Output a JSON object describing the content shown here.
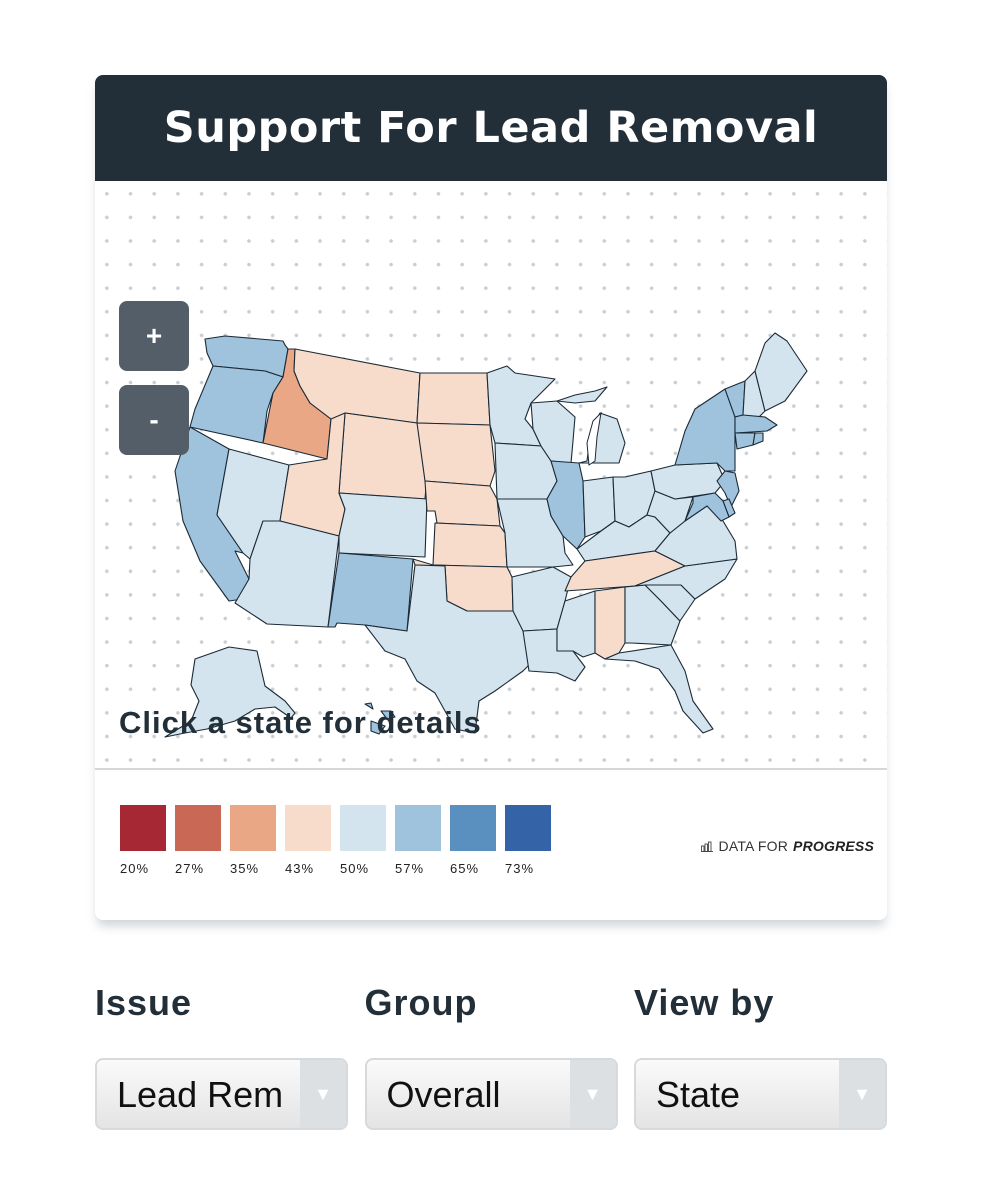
{
  "title": "Support For Lead Removal",
  "zoom_controls": {
    "zoom_in": "+",
    "zoom_out": "-"
  },
  "hint": "Click a state for details",
  "legend": {
    "items": [
      {
        "label": "20%",
        "color": "#a52834"
      },
      {
        "label": "27%",
        "color": "#c96955"
      },
      {
        "label": "35%",
        "color": "#e9a785"
      },
      {
        "label": "43%",
        "color": "#f7dccb"
      },
      {
        "label": "50%",
        "color": "#d4e4ef"
      },
      {
        "label": "57%",
        "color": "#9fc3dd"
      },
      {
        "label": "65%",
        "color": "#5a90c0"
      },
      {
        "label": "73%",
        "color": "#3563a8"
      }
    ]
  },
  "brand": {
    "icon": "bar-chart-icon",
    "prefix": "DATA FOR",
    "emphasis": "PROGRESS"
  },
  "controls": [
    {
      "label": "Issue",
      "value": "Lead Rem"
    },
    {
      "label": "Group",
      "value": "Overall"
    },
    {
      "label": "View by",
      "value": "State"
    }
  ],
  "map": {
    "colors": {
      "low": "#f7dccb",
      "mid_low": "#e9a785",
      "neutral": "#d4e4ef",
      "mid_high": "#9fc3dd"
    },
    "states": {
      "WA": "mid_high",
      "OR": "mid_high",
      "CA": "mid_high",
      "ID": "mid_low",
      "NV": "neutral",
      "MT": "low",
      "WY": "low",
      "UT": "low",
      "AZ": "neutral",
      "CO": "neutral",
      "NM": "mid_high",
      "ND": "low",
      "SD": "low",
      "NE": "low",
      "KS": "low",
      "OK": "low",
      "TX": "neutral",
      "MN": "neutral",
      "IA": "neutral",
      "MO": "neutral",
      "AR": "neutral",
      "LA": "neutral",
      "WI": "neutral",
      "IL": "mid_high",
      "MI": "neutral",
      "IN": "neutral",
      "OH": "neutral",
      "KY": "neutral",
      "TN": "low",
      "MS": "neutral",
      "AL": "low",
      "GA": "neutral",
      "FL": "neutral",
      "SC": "neutral",
      "NC": "neutral",
      "VA": "neutral",
      "WV": "neutral",
      "PA": "neutral",
      "NY": "mid_high",
      "VT": "mid_high",
      "NH": "neutral",
      "ME": "neutral",
      "MA": "mid_high",
      "CT": "mid_high",
      "RI": "mid_high",
      "NJ": "mid_high",
      "DE": "mid_high",
      "MD": "mid_high",
      "AK": "neutral",
      "HI": "mid_high"
    }
  }
}
